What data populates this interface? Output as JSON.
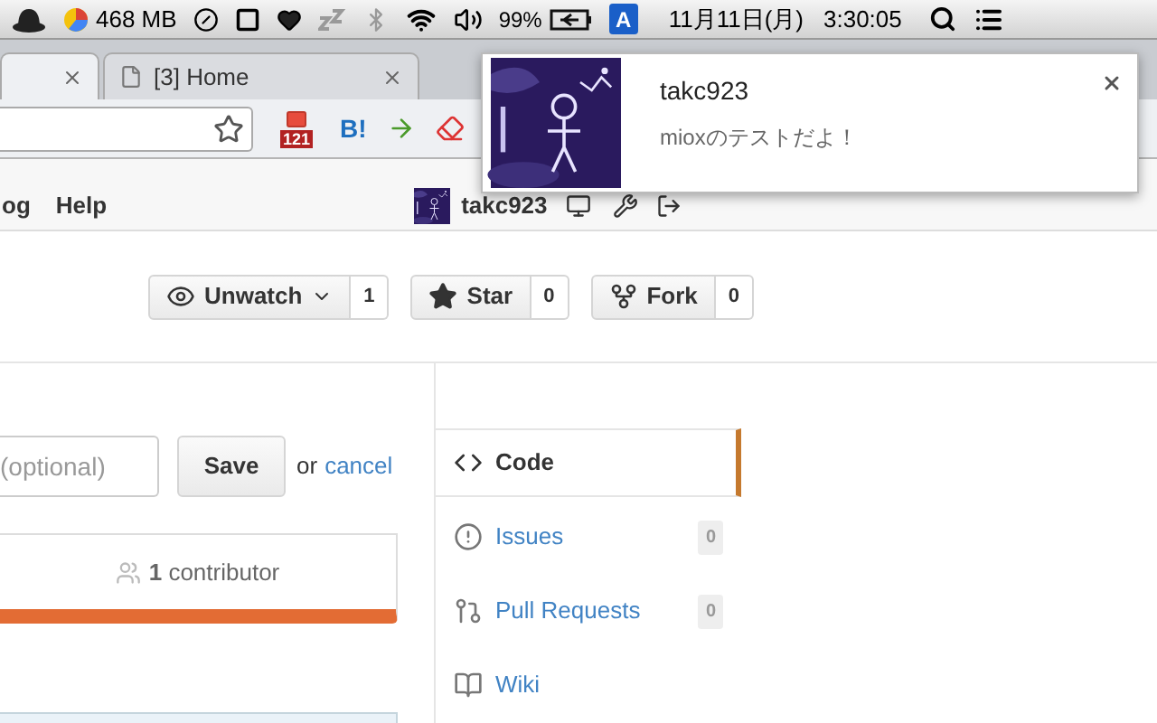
{
  "menubar": {
    "memory": "468 MB",
    "battery": "99%",
    "input_method": "A",
    "date": "11月11日(月)",
    "time": "3:30:05"
  },
  "tabs": [
    {
      "selected": true
    },
    {
      "title": "[3] Home",
      "selected": false
    }
  ],
  "extensions": {
    "mail_count": "121",
    "bookmark": "B!"
  },
  "site_nav": [
    "og",
    "Help"
  ],
  "user": {
    "name": "takc923"
  },
  "repo_actions": [
    {
      "kind": "watch",
      "label": "Unwatch",
      "count": "1"
    },
    {
      "kind": "star",
      "label": "Star",
      "count": "0"
    },
    {
      "kind": "fork",
      "label": "Fork",
      "count": "0"
    }
  ],
  "edit_form": {
    "placeholder": "(optional)",
    "save": "Save",
    "or": "or",
    "cancel": "cancel"
  },
  "contributors": "**1** contributor",
  "repo_nav": [
    {
      "kind": "code",
      "label": "Code",
      "selected": true
    },
    {
      "kind": "issues",
      "label": "Issues",
      "count": "0",
      "selected": false
    },
    {
      "kind": "pulls",
      "label": "Pull Requests",
      "count": "0",
      "selected": false
    },
    {
      "kind": "wiki",
      "label": "Wiki",
      "selected": false
    }
  ],
  "notification": {
    "title": "takc923",
    "message": "mioxのテストだよ！"
  }
}
